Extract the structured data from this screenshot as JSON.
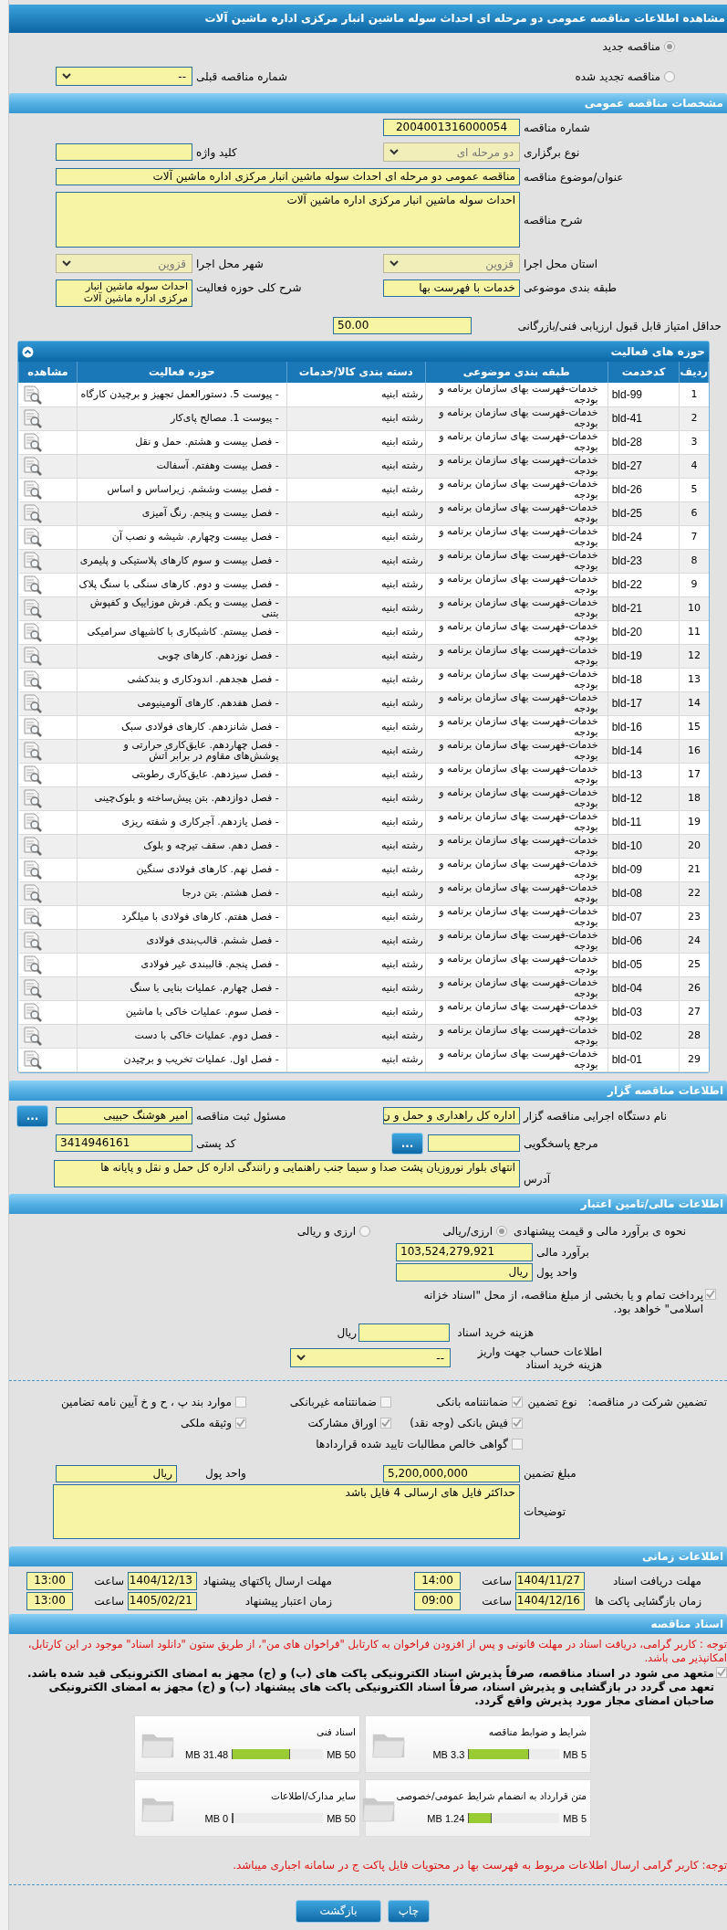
{
  "title": "مشاهده اطلاعات مناقصه عمومی دو مرحله ای احداث سوله ماشین انبار مرکزی اداره ماشین آلات",
  "tender_kind": [
    {
      "label": "مناقصه جدید",
      "selected": true
    },
    {
      "label": "مناقصه تجدید شده",
      "selected": false
    }
  ],
  "previous_tender": {
    "label": "شماره مناقصه قبلی",
    "value": "--",
    "disabled": false
  },
  "general": {
    "header": "مشخصات مناقصه عمومی",
    "number": {
      "label": "شماره مناقصه",
      "value": "2004001316000054"
    },
    "holding_type": {
      "label": "نوع برگزاری",
      "value": "دو مرحله ای",
      "disabled": true
    },
    "keyword": {
      "label": "کلید واژه"
    },
    "subject": {
      "label": "عنوان/موضوع مناقصه",
      "value": "مناقصه عمومی دو مرحله ای احداث سوله ماشین انبار مرکزی اداره ماشین آلات"
    },
    "description": {
      "label": "شرح مناقصه",
      "value": "احداث سوله ماشین انبار مرکزی اداره ماشین آلات"
    },
    "province": {
      "label": "استان محل اجرا",
      "value": "قزوین",
      "disabled": true
    },
    "city": {
      "label": "شهر محل اجرا",
      "value": "قزوین",
      "disabled": true
    },
    "category": {
      "label": "طبقه بندی موضوعی",
      "value": "خدمات با فهرست بها"
    },
    "activity_scope": {
      "label": "شرح کلی حوزه فعالیت",
      "value": "احداث سوله ماشین انبار مرکزی اداره ماشین آلات"
    },
    "min_score": {
      "label": "حداقل امتیاز قابل قبول ارزیابی فنی/بازرگانی",
      "value": "50.00"
    }
  },
  "activities": {
    "header": "حوزه های فعالیت",
    "expanded": true,
    "columns": [
      "ردیف",
      "کدخدمت",
      "طبقه بندی موضوعی",
      "دسته بندی کالا/خدمات",
      "حوزه فعالیت",
      "مشاهده"
    ],
    "rows": [
      {
        "index": "1",
        "code": "bld-99",
        "category": "خدمات-فهرست بهای سازمان برنامه و بودجه",
        "group": "رشته ابنیه",
        "activity": "- پیوست 5. دستورالعمل تجهیز و برچیدن کارگاه"
      },
      {
        "index": "2",
        "code": "bld-41",
        "category": "خدمات-فهرست بهای سازمان برنامه و بودجه",
        "group": "رشته ابنیه",
        "activity": "- پیوست 1. مصالح پای‌کار"
      },
      {
        "index": "3",
        "code": "bld-28",
        "category": "خدمات-فهرست بهای سازمان برنامه و بودجه",
        "group": "رشته ابنیه",
        "activity": "- فصل بیست و هشتم. حمل و نقل"
      },
      {
        "index": "4",
        "code": "bld-27",
        "category": "خدمات-فهرست بهای سازمان برنامه و بودجه",
        "group": "رشته ابنیه",
        "activity": "- فصل بیست وهفتم. آسفالت"
      },
      {
        "index": "5",
        "code": "bld-26",
        "category": "خدمات-فهرست بهای سازمان برنامه و بودجه",
        "group": "رشته ابنیه",
        "activity": "- فصل بیست وششم. زیراساس و اساس"
      },
      {
        "index": "6",
        "code": "bld-25",
        "category": "خدمات-فهرست بهای سازمان برنامه و بودجه",
        "group": "رشته ابنیه",
        "activity": "- فصل بیست و پنجم. رنگ آمیزی"
      },
      {
        "index": "7",
        "code": "bld-24",
        "category": "خدمات-فهرست بهای سازمان برنامه و بودجه",
        "group": "رشته ابنیه",
        "activity": "- فصل بیست وچهارم. شیشه و نصب آن"
      },
      {
        "index": "8",
        "code": "bld-23",
        "category": "خدمات-فهرست بهای سازمان برنامه و بودجه",
        "group": "رشته ابنیه",
        "activity": "- فصل بیست و سوم کارهای پلاستیکی و پلیمری"
      },
      {
        "index": "9",
        "code": "bld-22",
        "category": "خدمات-فهرست بهای سازمان برنامه و بودجه",
        "group": "رشته ابنیه",
        "activity": "- فصل بیست و دوم. کارهای سنگی با سنگ پلاک"
      },
      {
        "index": "10",
        "code": "bld-21",
        "category": "خدمات-فهرست بهای سازمان برنامه و بودجه",
        "group": "رشته ابنیه",
        "activity": "- فصل بیست و یکم. فرش موزاییک و کفپوش بتنی"
      },
      {
        "index": "11",
        "code": "bld-20",
        "category": "خدمات-فهرست بهای سازمان برنامه و بودجه",
        "group": "رشته ابنیه",
        "activity": "- فصل بیستم. کاشیکاری با کاشیهای سرامیکی"
      },
      {
        "index": "12",
        "code": "bld-19",
        "category": "خدمات-فهرست بهای سازمان برنامه و بودجه",
        "group": "رشته ابنیه",
        "activity": "- فصل نوزدهم. کارهای چوبی"
      },
      {
        "index": "13",
        "code": "bld-18",
        "category": "خدمات-فهرست بهای سازمان برنامه و بودجه",
        "group": "رشته ابنیه",
        "activity": "- فصل هجدهم. اندودکاری و بندکشی"
      },
      {
        "index": "14",
        "code": "bld-17",
        "category": "خدمات-فهرست بهای سازمان برنامه و بودجه",
        "group": "رشته ابنیه",
        "activity": "- فصل هفدهم. کارهای آلومینیومی"
      },
      {
        "index": "15",
        "code": "bld-16",
        "category": "خدمات-فهرست بهای سازمان برنامه و بودجه",
        "group": "رشته ابنیه",
        "activity": "- فصل شانزدهم. کارهای فولادی سبک"
      },
      {
        "index": "16",
        "code": "bld-14",
        "category": "خدمات-فهرست بهای سازمان برنامه و بودجه",
        "group": "رشته ابنیه",
        "activity": "- فصل چهاردهم. عایق‌کاری حرارتی و پوشش‌های مقاوم در برابر آتش"
      },
      {
        "index": "17",
        "code": "bld-13",
        "category": "خدمات-فهرست بهای سازمان برنامه و بودجه",
        "group": "رشته ابنیه",
        "activity": "- فصل سیزدهم. عایق‌کاری رطوبتی"
      },
      {
        "index": "18",
        "code": "bld-12",
        "category": "خدمات-فهرست بهای سازمان برنامه و بودجه",
        "group": "رشته ابنیه",
        "activity": "- فصل دوازدهم. بتن پیش‌ساخته و بلوک‌چینی"
      },
      {
        "index": "19",
        "code": "bld-11",
        "category": "خدمات-فهرست بهای سازمان برنامه و بودجه",
        "group": "رشته ابنیه",
        "activity": "- فصل یازدهم. آجرکاری و شفته ریزی"
      },
      {
        "index": "20",
        "code": "bld-10",
        "category": "خدمات-فهرست بهای سازمان برنامه و بودجه",
        "group": "رشته ابنیه",
        "activity": "- فصل دهم. سقف تیرچه و بلوک"
      },
      {
        "index": "21",
        "code": "bld-09",
        "category": "خدمات-فهرست بهای سازمان برنامه و بودجه",
        "group": "رشته ابنیه",
        "activity": "- فصل نهم. کارهای فولادی سنگین"
      },
      {
        "index": "22",
        "code": "bld-08",
        "category": "خدمات-فهرست بهای سازمان برنامه و بودجه",
        "group": "رشته ابنیه",
        "activity": "- فصل هشتم. بتن درجا"
      },
      {
        "index": "23",
        "code": "bld-07",
        "category": "خدمات-فهرست بهای سازمان برنامه و بودجه",
        "group": "رشته ابنیه",
        "activity": "- فصل هفتم. کارهای فولادی با میلگرد"
      },
      {
        "index": "24",
        "code": "bld-06",
        "category": "خدمات-فهرست بهای سازمان برنامه و بودجه",
        "group": "رشته ابنیه",
        "activity": "- فصل ششم. قالب‌بندی فولادی"
      },
      {
        "index": "25",
        "code": "bld-05",
        "category": "خدمات-فهرست بهای سازمان برنامه و بودجه",
        "group": "رشته ابنیه",
        "activity": "- فصل پنجم. قالببندی غیر فولادی"
      },
      {
        "index": "26",
        "code": "bld-04",
        "category": "خدمات-فهرست بهای سازمان برنامه و بودجه",
        "group": "رشته ابنیه",
        "activity": "- فصل چهارم. عملیات بنایی با سنگ"
      },
      {
        "index": "27",
        "code": "bld-03",
        "category": "خدمات-فهرست بهای سازمان برنامه و بودجه",
        "group": "رشته ابنیه",
        "activity": "- فصل سوم. عملیات خاکی با ماشین"
      },
      {
        "index": "28",
        "code": "bld-02",
        "category": "خدمات-فهرست بهای سازمان برنامه و بودجه",
        "group": "رشته ابنیه",
        "activity": "- فصل دوم. عملیات خاکی با دست"
      },
      {
        "index": "29",
        "code": "bld-01",
        "category": "خدمات-فهرست بهای سازمان برنامه و بودجه",
        "group": "رشته ابنیه",
        "activity": "- فصل اول. عملیات تخریب و برچیدن"
      }
    ]
  },
  "buyer": {
    "header": "اطلاعات مناقصه گزار",
    "organization": {
      "label": "نام دستگاه اجرایی مناقصه گزار",
      "value": "اداره کل راهداری و حمل و ن"
    },
    "registrar": {
      "label": "مسئول ثبت مناقصه",
      "value": "امیر هوشنگ حبیبی",
      "button": "..."
    },
    "reference": {
      "label": "مرجع پاسخگویی",
      "button": "..."
    },
    "postal_code": {
      "label": "کد پستی",
      "value": "3414946161"
    },
    "address": {
      "label": "آدرس",
      "value": "انتهای بلوار نوروزیان پشت صدا و سیما جنب راهنمایی و رانندگی اداره کل حمل و نقل و پایانه ها"
    }
  },
  "finance": {
    "header": "اطلاعات مالی/تامین اعتبار",
    "estimate_method": {
      "label": "نحوه ی برآورد مالی و قیمت پیشنهادی",
      "options": [
        {
          "label": "ارزی/ریالی",
          "selected": true
        },
        {
          "label": "ارزی و ریالی",
          "selected": false
        }
      ]
    },
    "estimate": {
      "label": "برآورد مالی",
      "value": "103,524,279,921"
    },
    "currency": {
      "label": "واحد پول",
      "value": "ریال"
    },
    "treasury": {
      "label": "پرداخت تمام و یا بخشی از مبلغ مناقصه، از محل \"اسناد خزانه اسلامی\" خواهد بود.",
      "checked": true
    },
    "document_fee": {
      "label": "هزینه خرید اسناد",
      "unit": "ریال"
    },
    "account": {
      "label": "اطلاعات حساب جهت واریز هزینه خرید اسناد",
      "value": "--"
    }
  },
  "guarantee": {
    "label": "تضمین شرکت در مناقصه:",
    "type_label": "نوع تضمین",
    "options": [
      {
        "label": "ضمانتنامه بانکی",
        "checked": true
      },
      {
        "label": "ضمانتنامه غیربانکی",
        "checked": false
      },
      {
        "label": "موارد بند پ ، ح و خ آیین نامه تضامین",
        "checked": false
      },
      {
        "label": "فیش بانکی (وجه نقد)",
        "checked": true
      },
      {
        "label": "اوراق مشارکت",
        "checked": true
      },
      {
        "label": "وثیقه ملکی",
        "checked": true
      },
      {
        "label": "گواهی خالص مطالبات تایید شده قراردادها",
        "checked": false
      }
    ],
    "amount": {
      "label": "مبلغ تضمین",
      "value": "5,200,000,000"
    },
    "currency": {
      "label": "واحد پول",
      "value": "ریال"
    },
    "notes": {
      "label": "توضیحات",
      "value": "حداکثر فایل های ارسالی 4 فایل باشد"
    }
  },
  "schedule": {
    "header": "اطلاعات زمانی",
    "items": [
      {
        "label": "مهلت دریافت اسناد",
        "date": "1404/11/27",
        "time_label": "ساعت",
        "time": "14:00"
      },
      {
        "label": "مهلت ارسال پاکتهای پیشنهاد",
        "date": "1404/12/13",
        "time_label": "ساعت",
        "time": "13:00"
      },
      {
        "label": "زمان بازگشایی پاکت ها",
        "date": "1404/12/16",
        "time_label": "ساعت",
        "time": "09:00"
      },
      {
        "label": "زمان اعتبار پیشنهاد",
        "date": "1405/02/21",
        "time_label": "ساعت",
        "time": "13:00"
      }
    ]
  },
  "documents": {
    "header": "اسناد مناقصه",
    "notice": "توجه : کاربر گرامی، دریافت اسناد در مهلت قانونی و پس از افزودن فراخوان به کارتابل \"فراخوان های من\"، از طریق ستون \"دانلود اسناد\" موجود در این کارتابل، امکانپذیر می باشد.",
    "commitment": {
      "text": "متعهد می شود در اسناد مناقصه، صرفاً پذیرش اسناد الکترونیکی پاکت های (ب) و (ج) مجهز به امضای الکترونیکی قید شده باشد. تعهد می گردد در بازگشایی و پذیرش اسناد، صرفاً اسناد الکترونیکی پاکت های پیشنهاد (ب) و (ج) مجهز به امضای الکترونیکی صاحبان امضای مجاز مورد پذیرش واقع گردد.",
      "checked": true
    },
    "files": [
      {
        "name": "شرایط و ضوابط مناقصه",
        "used": "3.3 MB",
        "max": "5 MB",
        "level": 0.66
      },
      {
        "name": "اسناد فنی",
        "used": "31.48 MB",
        "max": "50 MB",
        "level": 0.63
      },
      {
        "name": "متن قرارداد به انضمام شرایط عمومی/خصوصی",
        "used": "1.24 MB",
        "max": "5 MB",
        "level": 0.25
      },
      {
        "name": "سایر مدارک/اطلاعات",
        "used": "0 MB",
        "max": "50 MB",
        "level": 0
      }
    ],
    "footer_note": "توجه: کاربر گرامی ارسال اطلاعات مربوط به فهرست بها در محتویات فایل پاکت ج در سامانه اجباری میباشد."
  },
  "buttons": [
    "چاپ",
    "بازگشت"
  ]
}
